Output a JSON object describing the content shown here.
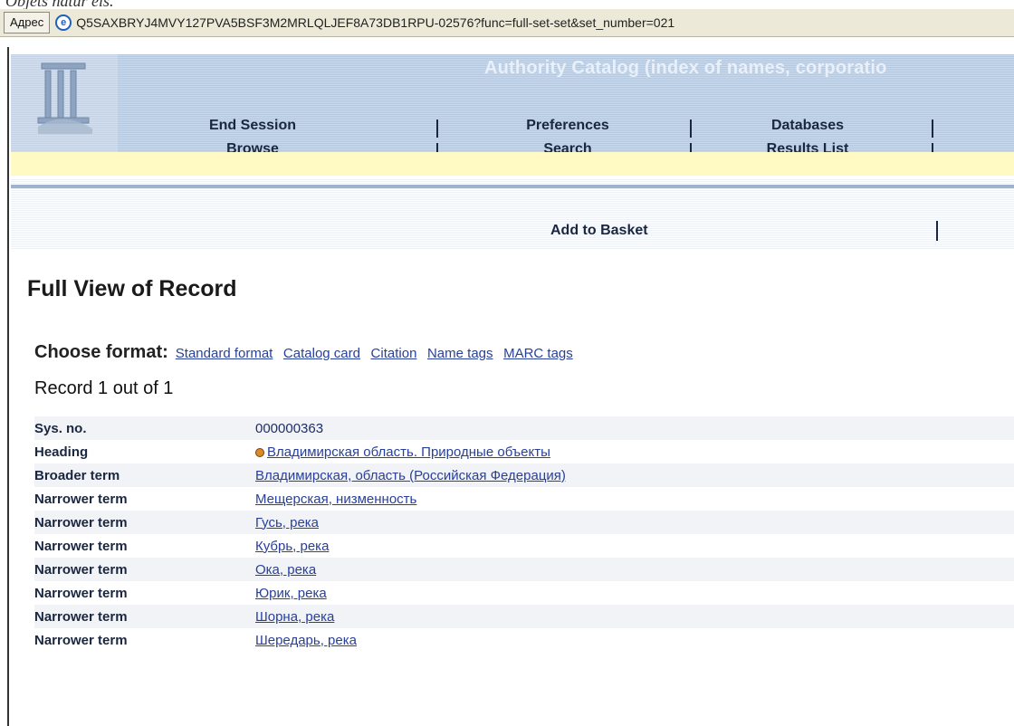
{
  "caption": "Objets natur els.",
  "browser": {
    "address_label": "Адрес",
    "url": "Q5SAXBRYJ4MVY127PVA5BSF3M2MRLQLJEF8A73DB1RPU-02576?func=full-set-set&set_number=021"
  },
  "banner": {
    "catalog_title": "Authority Catalog (index of names, corporatio",
    "nav_row1": [
      "End Session",
      "Preferences",
      "Databases"
    ],
    "nav_row2": [
      "Browse",
      "Search",
      "Results List"
    ],
    "basket_label": "Add to Basket"
  },
  "page_title": "Full View of Record",
  "format": {
    "label": "Choose format:",
    "options": [
      "Standard format",
      "Catalog card",
      "Citation",
      "Name tags",
      "MARC tags"
    ]
  },
  "record_count": "Record 1 out of 1",
  "fields": [
    {
      "label": "Sys. no.",
      "value": "000000363"
    },
    {
      "label": "Heading",
      "value": "Владимирская область. Природные объекты"
    },
    {
      "label": "Broader term",
      "value": "Владимирская, область (Российская Федерация)"
    },
    {
      "label": "Narrower term",
      "value": "Мещерская, низменность"
    },
    {
      "label": "Narrower term",
      "value": "Гусь, река"
    },
    {
      "label": "Narrower term",
      "value": "Кубрь, река"
    },
    {
      "label": "Narrower term",
      "value": "Ока, река"
    },
    {
      "label": "Narrower term",
      "value": "Юрик, река"
    },
    {
      "label": "Narrower term",
      "value": "Шорна, река"
    },
    {
      "label": "Narrower term",
      "value": "Шередарь, река"
    }
  ],
  "colors": {
    "banner_bg": "#c0d0e4",
    "highlight_bar": "#fff9c4",
    "link": "#28409a"
  },
  "icons": {
    "address_icon": "ie-page-icon",
    "heading_bullet": "bullet-icon"
  }
}
